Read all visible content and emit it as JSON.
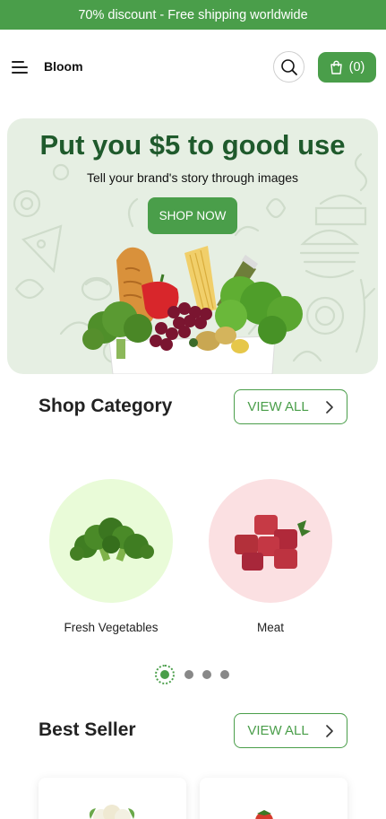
{
  "announcement": "70% discount - Free shipping worldwide",
  "header": {
    "brand": "Bloom",
    "cart_label": "(0)",
    "icons": {
      "menu": "hamburger-icon",
      "search": "search-icon",
      "cart": "shopping-bag-icon"
    }
  },
  "hero": {
    "title": "Put you $5 to good use",
    "subtitle": "Tell your brand's story through images",
    "button_label": "SHOP NOW"
  },
  "shop_category": {
    "title": "Shop Category",
    "view_all_label": "VIEW ALL",
    "items": [
      {
        "label": "Fresh Vegetables",
        "bg": "#e9fbd8"
      },
      {
        "label": "Meat",
        "bg": "#fbe0e2"
      }
    ],
    "carousel": {
      "total_dots": 4,
      "active_index": 0
    }
  },
  "best_seller": {
    "title": "Best Seller",
    "view_all_label": "VIEW ALL"
  },
  "colors": {
    "brand_green": "#4a9e4a",
    "title_green": "#1f5a2c",
    "hero_bg": "#e6efe3"
  }
}
